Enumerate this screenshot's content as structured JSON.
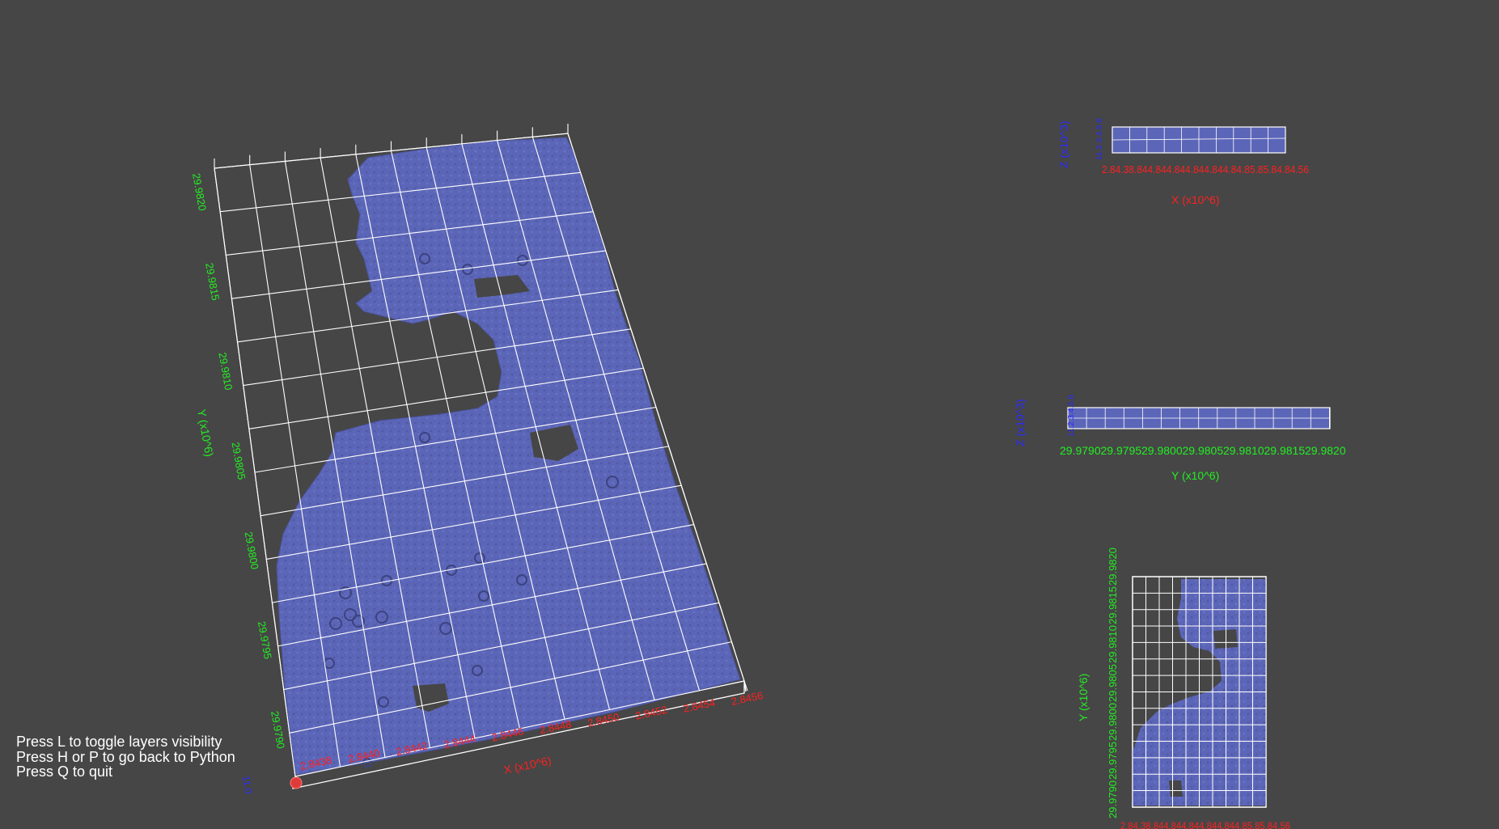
{
  "colors": {
    "background": "#464646",
    "surface": "#5c66b8",
    "surface_dark": "#4b549d",
    "grid": "#ffffff",
    "x_axis": "#ff2020",
    "y_axis": "#22ee22",
    "z_axis": "#2a2aff",
    "help_text": "#ffffff"
  },
  "help": {
    "line1": "Press L to toggle layers visibility",
    "line2": "Press H or P to go back to Python",
    "line3": "Press Q to quit"
  },
  "main_view": {
    "x_title": "X (x10^6)",
    "y_title": "Y (x10^6)",
    "x_ticks": [
      "2.8438",
      "2.8440",
      "2.8442",
      "2.8444",
      "2.8446",
      "2.8448",
      "2.8450",
      "2.8452",
      "2.8454",
      "2.8456"
    ],
    "y_ticks": [
      "29.9790",
      "29.9795",
      "29.9800",
      "29.9805",
      "29.9810",
      "29.9815",
      "29.9820"
    ],
    "z_tick": "11.0",
    "origin_marker": "red-sphere-icon"
  },
  "xz_view": {
    "x_title": "X (x10^6)",
    "z_title": "Z (x10^3)",
    "x_ticks_overlapping": "2.84.38.844.844.844.844.844.84.85.85.84.84.56",
    "z_ticks": "11.2.3.4.5.6"
  },
  "yz_view": {
    "y_title": "Y (x10^6)",
    "z_title": "Z (x10^3)",
    "y_ticks": [
      "29.9790",
      "29.9795",
      "29.9800",
      "29.9805",
      "29.9810",
      "29.9815",
      "29.9820"
    ],
    "z_ticks": "11.2.3.4.5.6"
  },
  "xy_view": {
    "y_title": "Y (x10^6)",
    "y_ticks": [
      "29.9790",
      "29.9795",
      "29.9800",
      "29.9805",
      "29.9810",
      "29.9815",
      "29.9820"
    ],
    "x_ticks_overlapping": "2.84.38.844.844.844.844.844.85.85.84.56"
  }
}
